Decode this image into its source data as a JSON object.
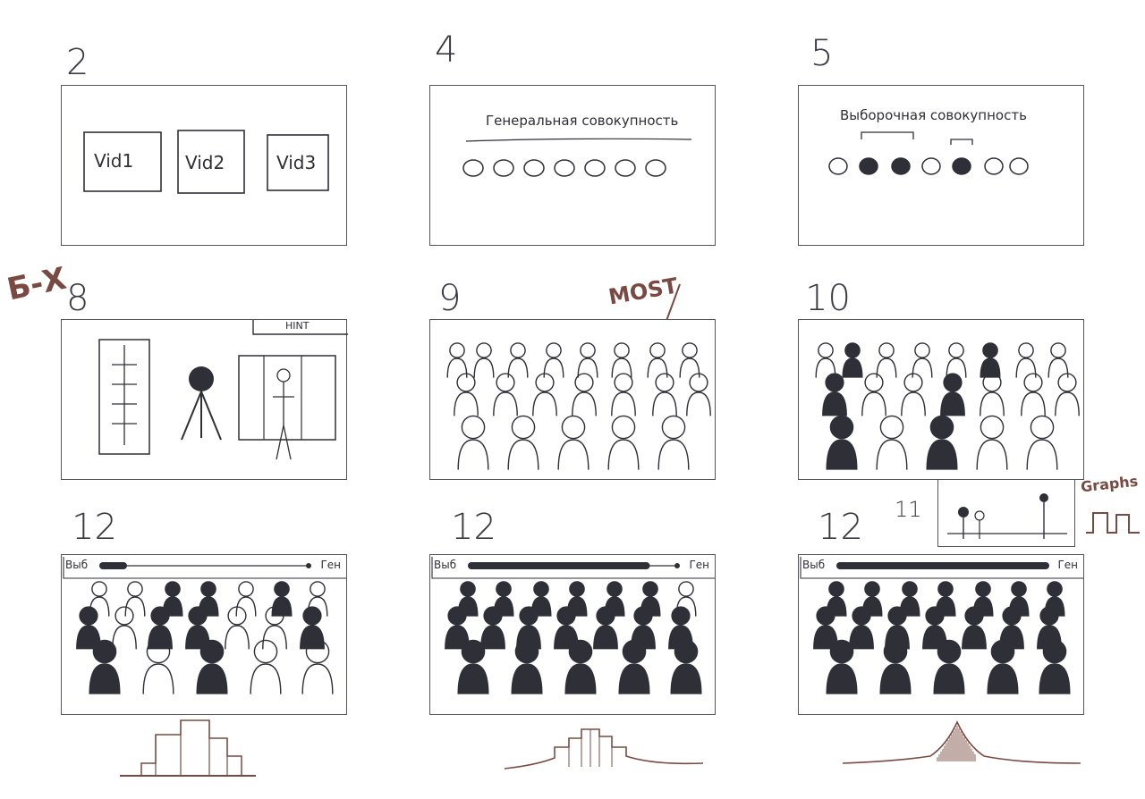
{
  "panels": [
    {
      "number": "2"
    },
    {
      "number": "4",
      "title": "Генеральная совокупность"
    },
    {
      "number": "5",
      "title": "Выборочная совокупность"
    },
    {
      "number": "8",
      "side_note": "Б-Х",
      "corner_label": "HINT"
    },
    {
      "number": "9",
      "annotation": "MOST"
    },
    {
      "number": "10"
    },
    {
      "number": "11",
      "annotation": "Graphs"
    },
    {
      "number": "12",
      "bar_left": "Выб",
      "bar_right": "Ген",
      "bar_fill": 0.1
    },
    {
      "number": "12",
      "bar_left": "Выб",
      "bar_right": "Ген",
      "bar_fill": 0.85
    },
    {
      "number": "12",
      "bar_left": "Выб",
      "bar_right": "Ген",
      "bar_fill": 1.0
    }
  ],
  "videos": [
    "Vid1",
    "Vid2",
    "Vid3"
  ],
  "colors": {
    "ink": "#2f2f38",
    "red_ink": "#7a4a42",
    "frame": "#55555d"
  }
}
